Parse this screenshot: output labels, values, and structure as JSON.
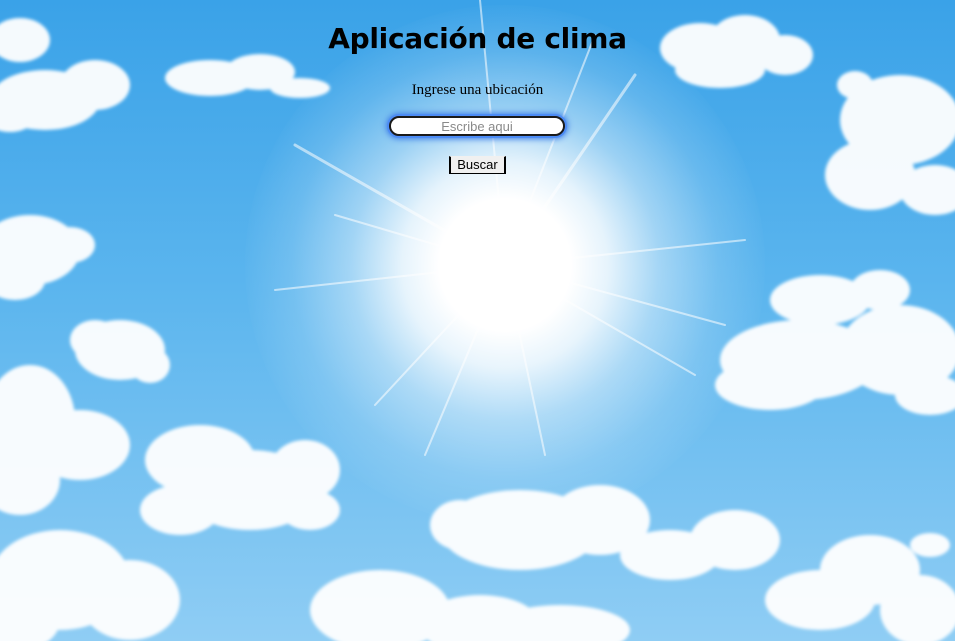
{
  "app": {
    "title": "Aplicación de clima"
  },
  "search": {
    "prompt_label": "Ingrese una ubicación",
    "placeholder": "Escribe aqui",
    "value": "",
    "button_label": "Buscar"
  },
  "background": {
    "sky_color": "#4aaeea",
    "sun_color": "#ffffff",
    "cloud_color": "#ffffff"
  },
  "colors": {
    "text": "#000000",
    "input_focus_ring": "#4d8cf5"
  }
}
